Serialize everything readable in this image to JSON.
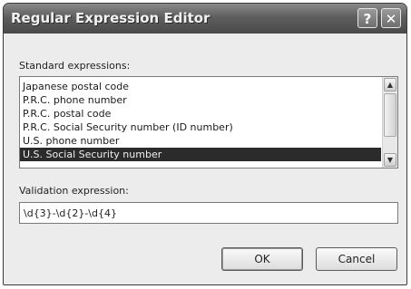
{
  "window": {
    "title": "Regular Expression Editor",
    "help_glyph": "?",
    "close_glyph": "✕"
  },
  "standard": {
    "label": "Standard expressions:",
    "items": [
      "Japanese postal code",
      "P.R.C. phone number",
      "P.R.C. postal code",
      "P.R.C. Social Security number (ID number)",
      "U.S. phone number",
      "U.S. Social Security number"
    ],
    "selected_index": 5
  },
  "validation": {
    "label": "Validation expression:",
    "value": "\\d{3}-\\d{2}-\\d{4}"
  },
  "buttons": {
    "ok": "OK",
    "cancel": "Cancel"
  },
  "icons": {
    "scroll_up": "up-arrow-icon",
    "scroll_down": "down-arrow-icon"
  }
}
